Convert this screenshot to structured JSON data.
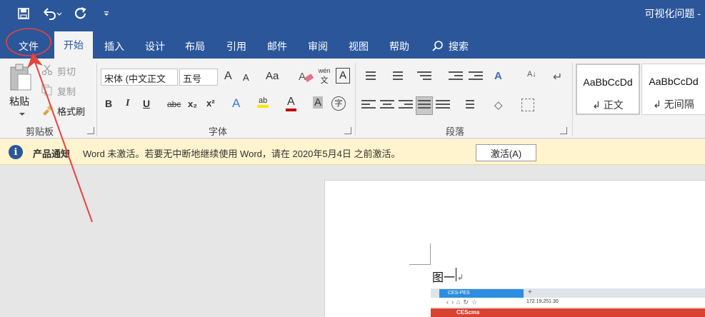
{
  "title_bar": {
    "doc_title": "可视化问题 -",
    "qat_icons": [
      "save-icon",
      "undo-icon",
      "redo-icon",
      "customize-qat-icon"
    ]
  },
  "tabs": [
    {
      "label": "文件"
    },
    {
      "label": "开始"
    },
    {
      "label": "插入"
    },
    {
      "label": "设计"
    },
    {
      "label": "布局"
    },
    {
      "label": "引用"
    },
    {
      "label": "邮件"
    },
    {
      "label": "审阅"
    },
    {
      "label": "视图"
    },
    {
      "label": "帮助"
    },
    {
      "label": "搜索"
    }
  ],
  "ribbon": {
    "clipboard": {
      "paste": "粘贴",
      "cut": "剪切",
      "copy": "复制",
      "format_painter": "格式刷",
      "label": "剪贴板"
    },
    "font": {
      "font_name": "宋体 (中文正文",
      "font_size": "五号",
      "grow": "A",
      "shrink": "A",
      "change_case": "Aa",
      "phonetic_top": "wén",
      "phonetic_bottom": "文",
      "border_char": "A",
      "bold": "B",
      "italic": "I",
      "underline": "U",
      "strike": "abc",
      "subscript": "x₂",
      "superscript": "x²",
      "effects": "A",
      "highlight": "ab",
      "font_color": "A",
      "shading": "A",
      "enclose": "字",
      "label": "字体"
    },
    "paragraph": {
      "label": "段落"
    },
    "styles": [
      {
        "sample": "AaBbCcDd",
        "name": "↲ 正文"
      },
      {
        "sample": "AaBbCcDd",
        "name": "↲ 无间隔"
      }
    ]
  },
  "notification": {
    "title": "产品通知",
    "message": "Word 未激活。若要无中断地继续使用 Word，请在 2020年5月4日 之前激活。",
    "button": "激活(A)"
  },
  "document": {
    "text": "图一",
    "pilcrow": "↲"
  },
  "embedded_screenshot": {
    "tab_title": "CES-PES",
    "url": "172.19.251.30",
    "brand": "CEScms"
  },
  "colors": {
    "title_bar": "#2b579a",
    "ribbon": "#f3f3f3",
    "notification": "#fff4ce",
    "annotation": "#e8433a"
  }
}
